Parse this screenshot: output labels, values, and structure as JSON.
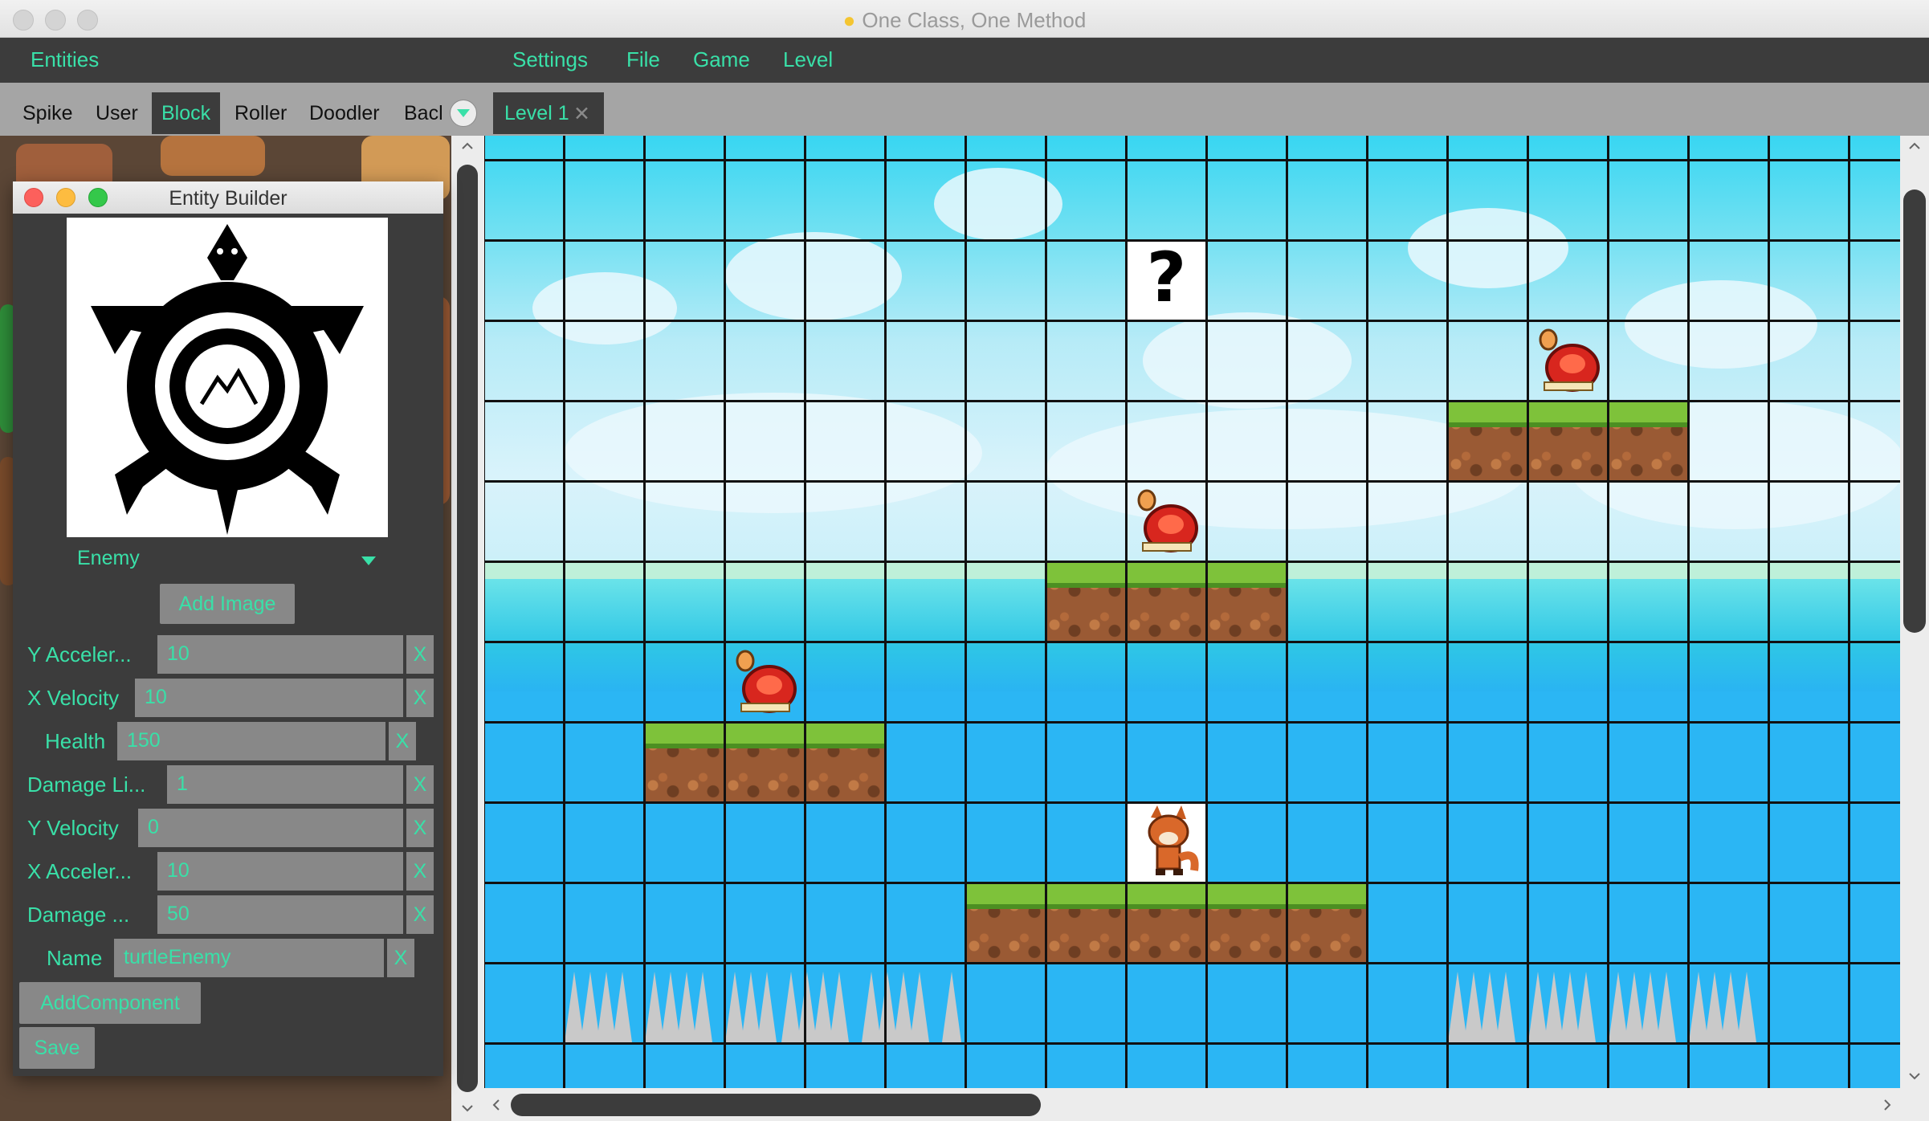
{
  "window": {
    "title": "One Class, One Method"
  },
  "menubar": {
    "left": "Entities",
    "items": [
      "Settings",
      "File",
      "Game",
      "Level"
    ]
  },
  "entity_tabs": [
    "Spike",
    "User",
    "Block",
    "Roller",
    "Doodler",
    "Bacl"
  ],
  "entity_tabs_active": "Block",
  "level_tab": {
    "label": "Level 1",
    "close": "✕"
  },
  "builder": {
    "title": "Entity Builder",
    "type": "Enemy",
    "add_image": "Add Image",
    "properties": [
      {
        "label": "Y Acceler...",
        "value": "10",
        "delete": "X"
      },
      {
        "label": "X Velocity",
        "value": "10",
        "delete": "X"
      },
      {
        "label": "Health",
        "value": "150",
        "delete": "X"
      },
      {
        "label": "Damage Li...",
        "value": "1",
        "delete": "X"
      },
      {
        "label": "Y Velocity",
        "value": "0",
        "delete": "X"
      },
      {
        "label": "X Acceler...",
        "value": "10",
        "delete": "X"
      },
      {
        "label": "Damage ...",
        "value": "50",
        "delete": "X"
      },
      {
        "label": "Name",
        "value": "turtleEnemy",
        "delete": "X"
      }
    ],
    "add_component": "AddComponent",
    "save": "Save"
  },
  "level": {
    "question_block": "?"
  },
  "colors": {
    "accent": "#39e0a8",
    "panel": "#3c3c3c",
    "field": "#888888"
  }
}
